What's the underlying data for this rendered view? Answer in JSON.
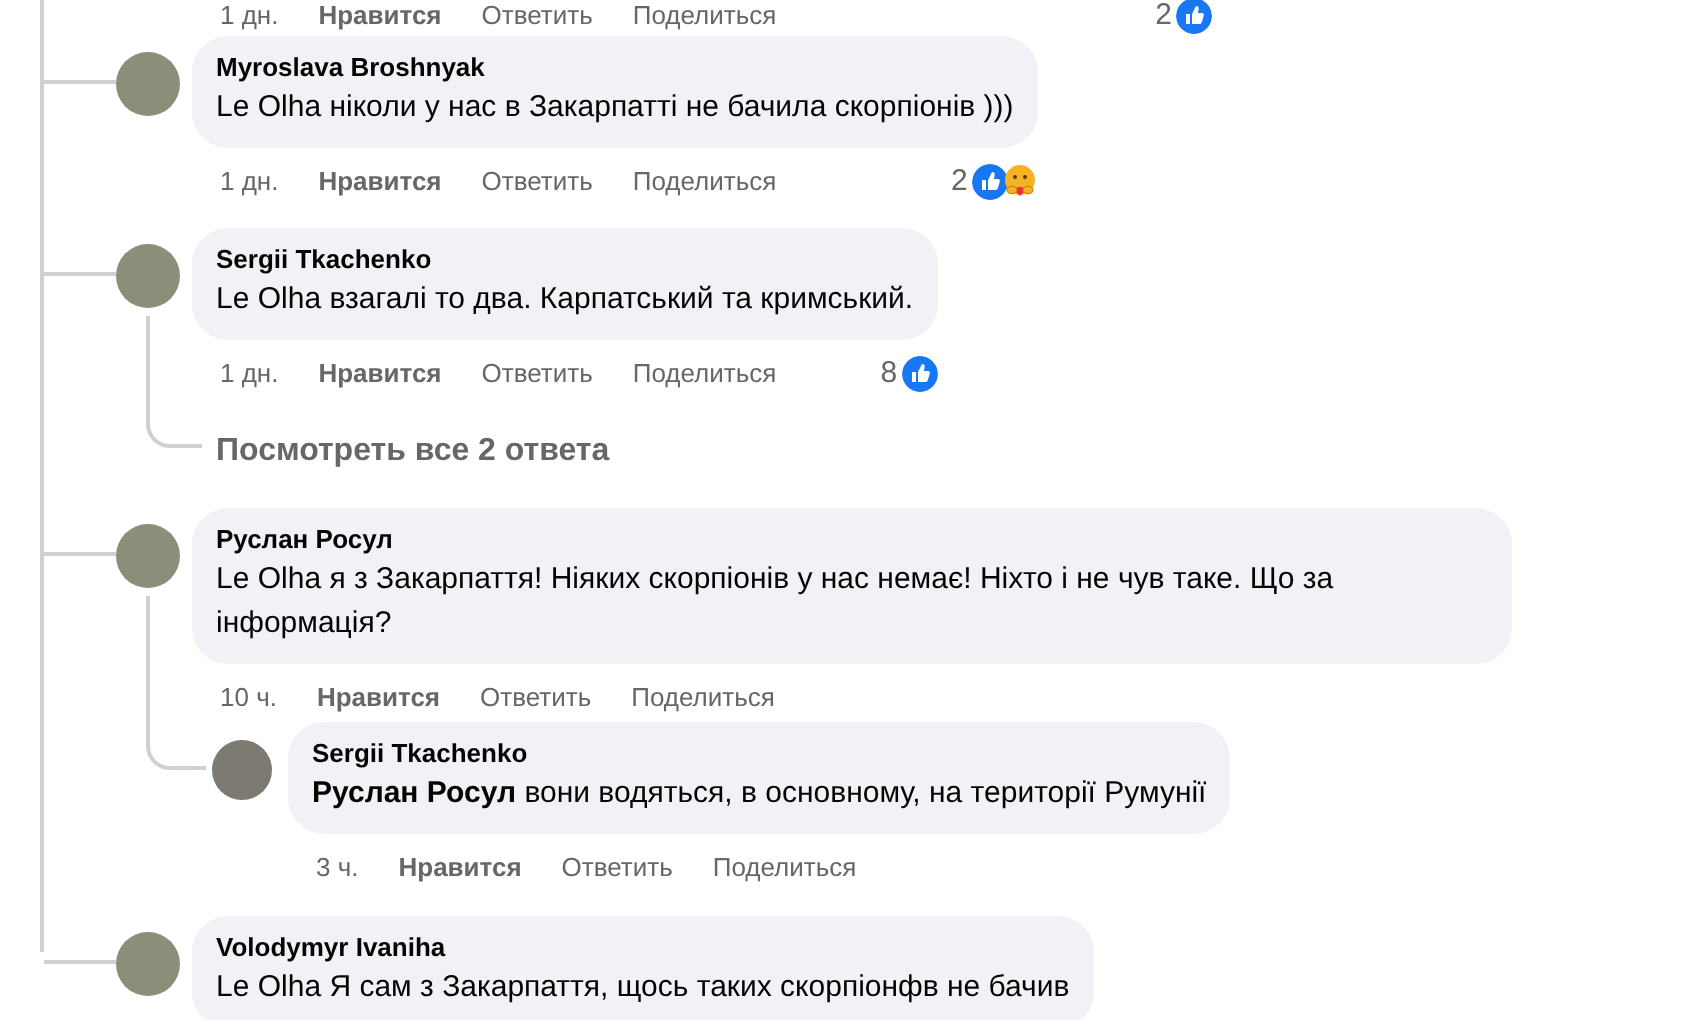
{
  "top_actions": {
    "time": "1 дн.",
    "like": "Нравится",
    "reply": "Ответить",
    "share": "Поделиться",
    "reaction_count": "2",
    "reactions": [
      {
        "kind": "like"
      }
    ]
  },
  "comments": [
    {
      "author": "Myroslava Broshnyak",
      "text": "Le Olha ніколи у нас в Закарпатті не бачила скорпіонів )))",
      "time": "1 дн.",
      "like": "Нравится",
      "reply": "Ответить",
      "share": "Поделиться",
      "reaction_count": "2",
      "reactions": [
        {
          "kind": "like"
        },
        {
          "kind": "care"
        }
      ]
    },
    {
      "author": "Sergii Tkachenko",
      "text": "Le Olha взагалі то два. Карпатський та кримський.",
      "time": "1 дн.",
      "like": "Нравится",
      "reply": "Ответить",
      "share": "Поделиться",
      "reaction_count": "8",
      "reactions": [
        {
          "kind": "like"
        }
      ],
      "view_replies": "Посмотреть все 2 ответа"
    },
    {
      "author": "Руслан Росул",
      "text": "Le Olha я з Закарпаття! Ніяких скорпіонів у нас немає! Ніхто і не чув таке. Що за інформація?",
      "time": "10 ч.",
      "like": "Нравится",
      "reply": "Ответить",
      "share": "Поделиться",
      "replies": [
        {
          "author": "Sergii Tkachenko",
          "text": "**Руслан Росул** вони водяться, в основному, на території Румунії",
          "time": "3 ч.",
          "like": "Нравится",
          "reply": "Ответить",
          "share": "Поделиться"
        }
      ]
    },
    {
      "author": "Volodymyr Ivaniha",
      "text": "Le Olha Я сам з Закарпаття, щось таких скорпіонфв не бачив"
    }
  ]
}
